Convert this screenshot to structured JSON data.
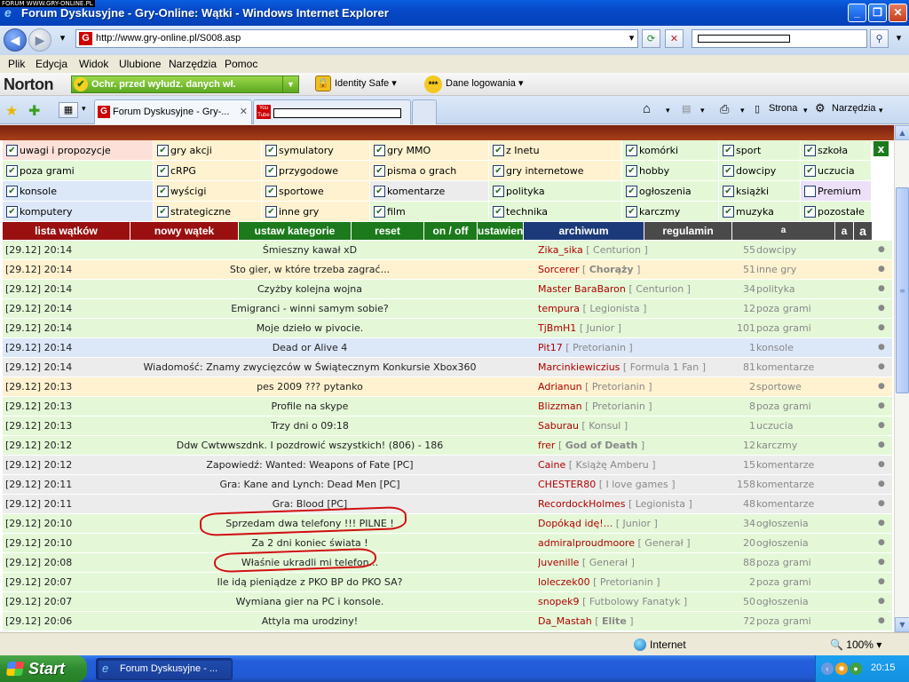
{
  "watermark": "FORUM WWW.GRY-ONLINE.PL",
  "window": {
    "title": "Forum Dyskusyjne - Gry-Online: Wątki - Windows Internet Explorer"
  },
  "address": {
    "url": "http://www.gry-online.pl/S008.asp"
  },
  "menu": [
    "Plik",
    "Edycja",
    "Widok",
    "Ulubione",
    "Narzędzia",
    "Pomoc"
  ],
  "norton": {
    "logo": "Norton",
    "phishing": "Ochr. przed wyłudz. danych wł.",
    "identity_safe": "Identity Safe",
    "logins": "Dane logowania"
  },
  "tabs": [
    {
      "label": "Forum Dyskusyjne - Gry-..."
    }
  ],
  "toolbar": {
    "page": "Strona",
    "tools": "Narzędzia"
  },
  "categories": [
    [
      {
        "label": "uwagi i propozycje",
        "checked": true,
        "color": "#fde0d8"
      },
      {
        "label": "gry akcji",
        "checked": true,
        "color": "#fff2d0"
      },
      {
        "label": "symulatory",
        "checked": true,
        "color": "#fff2d0"
      },
      {
        "label": "gry MMO",
        "checked": true,
        "color": "#fff2d0"
      },
      {
        "label": "z Inetu",
        "checked": true,
        "color": "#fff2d0"
      },
      {
        "label": "komórki",
        "checked": true,
        "color": "#e4f8d8"
      },
      {
        "label": "sport",
        "checked": true,
        "color": "#e4f8d8"
      },
      {
        "label": "szkoła",
        "checked": true,
        "color": "#e4f8d8"
      }
    ],
    [
      {
        "label": "poza grami",
        "checked": true,
        "color": "#e4f8d8"
      },
      {
        "label": "cRPG",
        "checked": true,
        "color": "#fff2d0"
      },
      {
        "label": "przygodowe",
        "checked": true,
        "color": "#fff2d0"
      },
      {
        "label": "pisma o grach",
        "checked": true,
        "color": "#fff2d0"
      },
      {
        "label": "gry internetowe",
        "checked": true,
        "color": "#fff2d0"
      },
      {
        "label": "hobby",
        "checked": true,
        "color": "#e4f8d8"
      },
      {
        "label": "dowcipy",
        "checked": true,
        "color": "#e4f8d8"
      },
      {
        "label": "uczucia",
        "checked": true,
        "color": "#e4f8d8"
      }
    ],
    [
      {
        "label": "konsole",
        "checked": true,
        "color": "#dce8f8"
      },
      {
        "label": "wyścigi",
        "checked": true,
        "color": "#fff2d0"
      },
      {
        "label": "sportowe",
        "checked": true,
        "color": "#fff2d0"
      },
      {
        "label": "komentarze",
        "checked": true,
        "color": "#ececec"
      },
      {
        "label": "polityka",
        "checked": true,
        "color": "#e4f8d8"
      },
      {
        "label": "ogłoszenia",
        "checked": true,
        "color": "#e4f8d8"
      },
      {
        "label": "książki",
        "checked": true,
        "color": "#e4f8d8"
      },
      {
        "label": "Premium",
        "checked": false,
        "color": "#ece0f8"
      }
    ],
    [
      {
        "label": "komputery",
        "checked": true,
        "color": "#dce8f8"
      },
      {
        "label": "strategiczne",
        "checked": true,
        "color": "#fff2d0"
      },
      {
        "label": "inne gry",
        "checked": true,
        "color": "#fff2d0"
      },
      {
        "label": "film",
        "checked": true,
        "color": "#e4f8d8"
      },
      {
        "label": "technika",
        "checked": true,
        "color": "#e4f8d8"
      },
      {
        "label": "karczmy",
        "checked": true,
        "color": "#e4f8d8"
      },
      {
        "label": "muzyka",
        "checked": true,
        "color": "#e4f8d8"
      },
      {
        "label": "pozostałe",
        "checked": true,
        "color": "#e4f8d8"
      }
    ]
  ],
  "close_label": "x",
  "nav": [
    {
      "label": "lista wątków",
      "color": "#9a1010"
    },
    {
      "label": "nowy wątek",
      "color": "#9a1010"
    },
    {
      "label": "ustaw kategorie",
      "color": "#1c7a1c"
    },
    {
      "label": "reset",
      "color": "#1c7a1c"
    },
    {
      "label": "on / off",
      "color": "#1c7a1c"
    },
    {
      "label": "ustawienia",
      "color": "#1c7a1c"
    },
    {
      "label": "archiwum",
      "color": "#1c3a7a"
    },
    {
      "label": "regulamin",
      "color": "#4a4a4a"
    },
    {
      "label": "a",
      "color": "#4a4a4a"
    },
    {
      "label": "a",
      "color": "#4a4a4a"
    },
    {
      "label": "a",
      "color": "#4a4a4a"
    }
  ],
  "threads": [
    {
      "date": "[29.12] 20:14",
      "title": "Śmieszny kawał xD",
      "author": "Zika_sika",
      "rank": "Centurion",
      "count": "55",
      "cat": "dowcipy",
      "color": "#e4f8d8"
    },
    {
      "date": "[29.12] 20:14",
      "title": "Sto gier, w które trzeba zagrać...",
      "author": "Sorcerer",
      "rank": "Chorąży",
      "rank_bold": true,
      "count": "51",
      "cat": "inne gry",
      "color": "#fff2d0"
    },
    {
      "date": "[29.12] 20:14",
      "title": "Czyżby kolejna wojna",
      "author": "Master BaraBaron",
      "rank": "Centurion",
      "count": "34",
      "cat": "polityka",
      "color": "#e4f8d8"
    },
    {
      "date": "[29.12] 20:14",
      "title": "Emigranci - winni samym sobie?",
      "author": "tempura",
      "rank": "Legionista",
      "count": "12",
      "cat": "poza grami",
      "color": "#e4f8d8"
    },
    {
      "date": "[29.12] 20:14",
      "title": "Moje dzieło w pivocie.",
      "author": "TjBmH1",
      "rank": "Junior",
      "count": "101",
      "cat": "poza grami",
      "color": "#e4f8d8"
    },
    {
      "date": "[29.12] 20:14",
      "title": "Dead or Alive 4",
      "author": "Pit17",
      "rank": "Pretorianin",
      "count": "1",
      "cat": "konsole",
      "color": "#dce8f8"
    },
    {
      "date": "[29.12] 20:14",
      "title": "Wiadomość: Znamy zwycięzców w Świątecznym Konkursie Xbox360",
      "author": "Marcinkiewiczius",
      "rank": "Formula 1 Fan",
      "count": "81",
      "cat": "komentarze",
      "color": "#ececec"
    },
    {
      "date": "[29.12] 20:13",
      "title": "pes 2009 ??? pytanko",
      "author": "Adrianun",
      "rank": "Pretorianin",
      "count": "2",
      "cat": "sportowe",
      "color": "#fff2d0"
    },
    {
      "date": "[29.12] 20:13",
      "title": "Profile na skype",
      "author": "Blizzman",
      "rank": "Pretorianin",
      "count": "8",
      "cat": "poza grami",
      "color": "#e4f8d8"
    },
    {
      "date": "[29.12] 20:13",
      "title": "Trzy dni o 09:18",
      "author": "Saburau",
      "rank": "Konsul",
      "count": "1",
      "cat": "uczucia",
      "color": "#e4f8d8"
    },
    {
      "date": "[29.12] 20:12",
      "title": "Ddw Cwtwwszdnk. I pozdrowić wszystkich! (806) - 186",
      "author": "frer",
      "rank": "God of Death",
      "rank_bold": true,
      "count": "12",
      "cat": "karczmy",
      "color": "#e4f8d8"
    },
    {
      "date": "[29.12] 20:12",
      "title": "Zapowiedź: Wanted: Weapons of Fate [PC]",
      "author": "Caine",
      "rank": "Książę Amberu",
      "count": "15",
      "cat": "komentarze",
      "color": "#ececec"
    },
    {
      "date": "[29.12] 20:11",
      "title": "Gra: Kane and Lynch: Dead Men [PC]",
      "author": "CHESTER80",
      "rank": "I love games",
      "count": "158",
      "cat": "komentarze",
      "color": "#ececec"
    },
    {
      "date": "[29.12] 20:11",
      "title": "Gra: Blood [PC]",
      "author": "RecordockHolmes",
      "rank": "Legionista",
      "count": "48",
      "cat": "komentarze",
      "color": "#ececec"
    },
    {
      "date": "[29.12] 20:10",
      "title": "Sprzedam dwa telefony !!! PILNE !",
      "author": "Dopókąd idę!...",
      "rank": "Junior",
      "count": "34",
      "cat": "ogłoszenia",
      "color": "#e4f8d8"
    },
    {
      "date": "[29.12] 20:10",
      "title": "Za 2 dni koniec świata !",
      "author": "admiralproudmoore",
      "rank": "Generał",
      "count": "20",
      "cat": "ogłoszenia",
      "color": "#e4f8d8"
    },
    {
      "date": "[29.12] 20:08",
      "title": "Właśnie ukradli mi telefon...",
      "author": "Juvenille",
      "rank": "Generał",
      "count": "88",
      "cat": "poza grami",
      "color": "#e4f8d8"
    },
    {
      "date": "[29.12] 20:07",
      "title": "Ile idą pieniądze z PKO BP do PKO SA?",
      "author": "loleczek00",
      "rank": "Pretorianin",
      "count": "2",
      "cat": "poza grami",
      "color": "#e4f8d8"
    },
    {
      "date": "[29.12] 20:07",
      "title": "Wymiana gier na PC i konsole.",
      "author": "snopek9",
      "rank": "Futbolowy Fanatyk",
      "count": "50",
      "cat": "ogłoszenia",
      "color": "#e4f8d8"
    },
    {
      "date": "[29.12] 20:06",
      "title": "Attyla ma urodziny!",
      "author": "Da_Mastah",
      "rank": "Elite",
      "rank_bold": true,
      "count": "72",
      "cat": "poza grami",
      "color": "#e4f8d8"
    }
  ],
  "status": {
    "zone": "Internet",
    "zoom": "100%"
  },
  "taskbar": {
    "start": "Start",
    "task": "Forum Dyskusyjne - ...",
    "time": "20:15"
  }
}
